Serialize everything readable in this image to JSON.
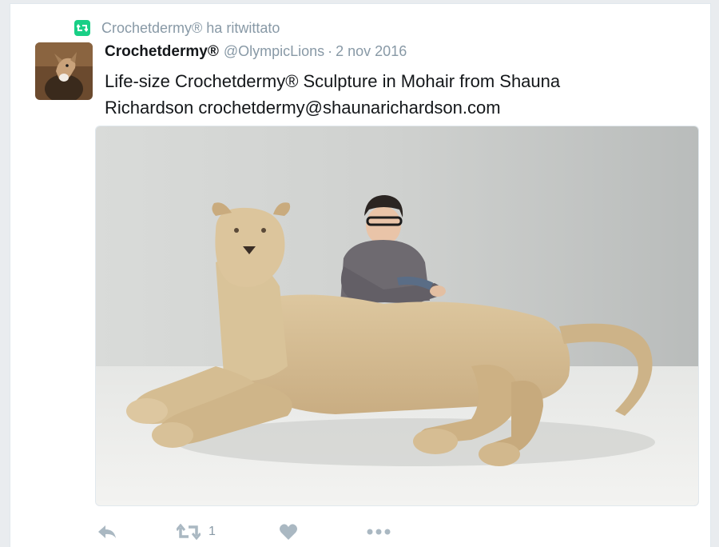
{
  "retweet_context": {
    "icon": "retweet-icon",
    "text": "Crochetdermy® ha ritwittato"
  },
  "tweet": {
    "author_name": "Crochetdermy®",
    "author_handle": "@OlympicLions",
    "separator": "·",
    "date": "2 nov 2016",
    "text_line1": "Life-size Crochetdermy® Sculpture in Mohair from Shauna",
    "text_line2": "Richardson crochetdermy@shaunarichardson.com"
  },
  "actions": {
    "reply_icon": "reply-icon",
    "retweet_icon": "retweet-icon",
    "retweet_count": "1",
    "like_icon": "heart-icon",
    "more_icon": "more-icon"
  },
  "colors": {
    "retweet_green": "#19cf86",
    "muted_gray": "#8899a6",
    "text_dark": "#14171a",
    "action_gray": "#aab8c2"
  }
}
